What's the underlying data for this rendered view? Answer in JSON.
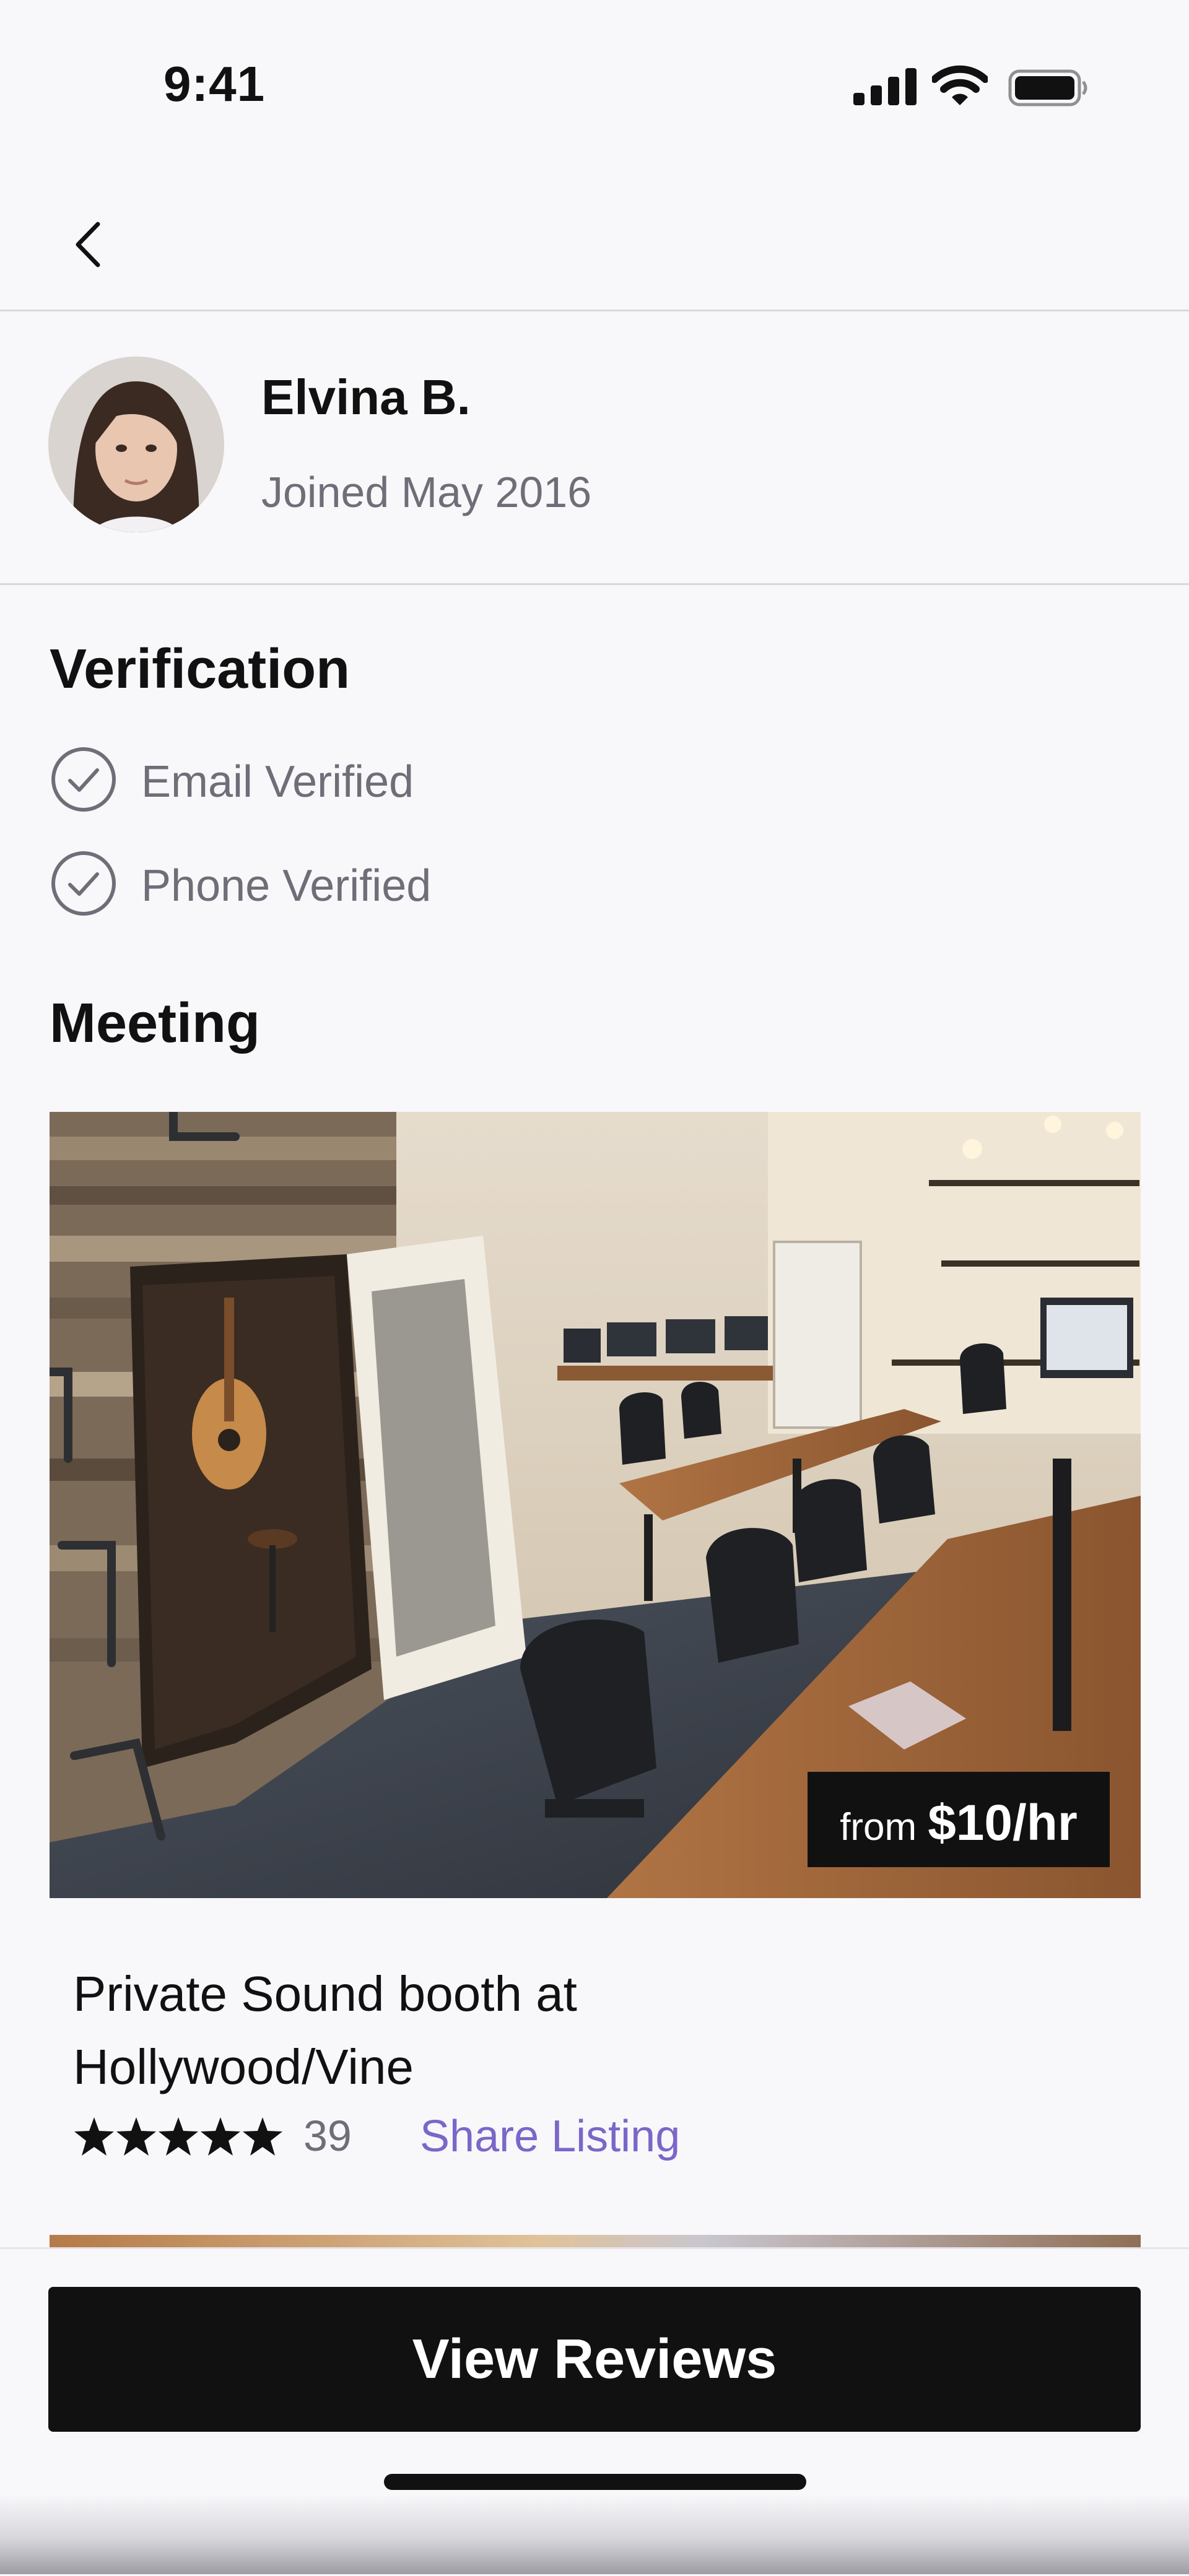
{
  "status_bar": {
    "time": "9:41"
  },
  "profile": {
    "name": "Elvina B.",
    "joined": "Joined May 2016"
  },
  "verification": {
    "title": "Verification",
    "items": [
      {
        "label": "Email Verified"
      },
      {
        "label": "Phone Verified"
      }
    ]
  },
  "meeting": {
    "title": "Meeting",
    "listing": {
      "price_prefix": "from",
      "price": "$10/hr",
      "title_line1": "Private Sound booth at",
      "title_line2": "Hollywood/Vine",
      "rating_stars": 5,
      "review_count": "39",
      "share_label": "Share Listing"
    }
  },
  "cta": {
    "label": "View Reviews"
  },
  "colors": {
    "accent": "#7b66c9",
    "primary": "#111111",
    "muted": "#6f6e78"
  }
}
